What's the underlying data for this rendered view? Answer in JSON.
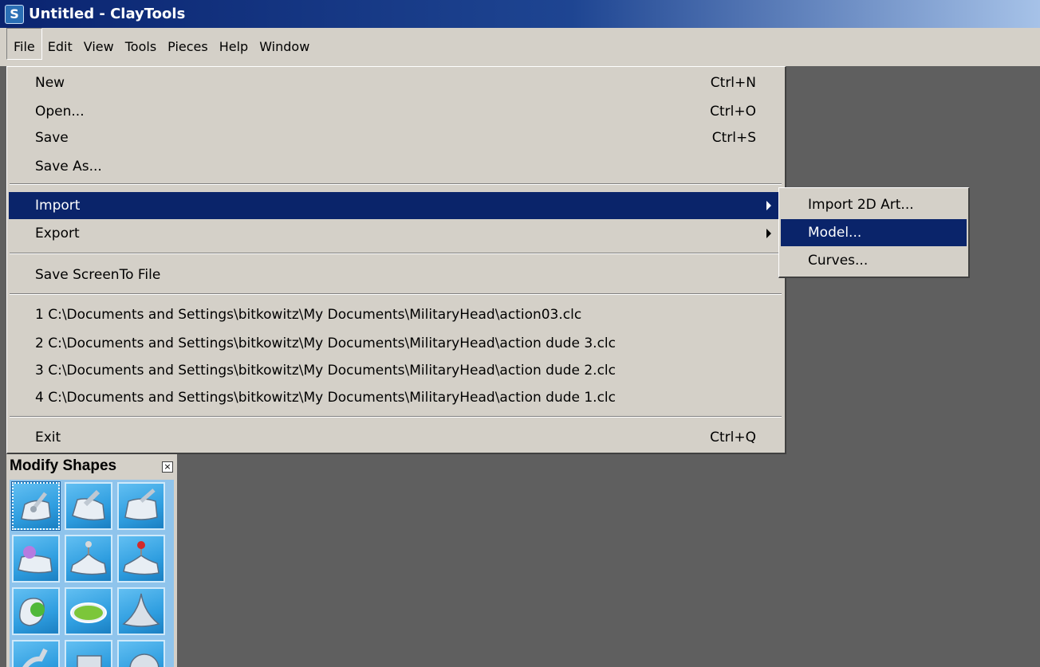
{
  "window": {
    "title": "Untitled - ClayTools",
    "icon": "app-logo-icon"
  },
  "menubar": {
    "items": [
      {
        "label": "File",
        "open": true
      },
      {
        "label": "Edit"
      },
      {
        "label": "View"
      },
      {
        "label": "Tools"
      },
      {
        "label": "Pieces"
      },
      {
        "label": "Help"
      },
      {
        "label": "Window"
      }
    ]
  },
  "file_menu": {
    "new": {
      "label": "New",
      "shortcut": "Ctrl+N"
    },
    "open": {
      "label": "Open...",
      "shortcut": "Ctrl+O"
    },
    "save": {
      "label": "Save",
      "shortcut": "Ctrl+S"
    },
    "save_as": {
      "label": "Save As..."
    },
    "import": {
      "label": "Import",
      "has_submenu": true,
      "highlighted": true
    },
    "export": {
      "label": "Export",
      "has_submenu": true
    },
    "save_screen": {
      "label": "Save ScreenTo File"
    },
    "recent": [
      "1 C:\\Documents and Settings\\bitkowitz\\My Documents\\MilitaryHead\\action03.clc",
      "2 C:\\Documents and Settings\\bitkowitz\\My Documents\\MilitaryHead\\action dude 3.clc",
      "3 C:\\Documents and Settings\\bitkowitz\\My Documents\\MilitaryHead\\action dude 2.clc",
      "4 C:\\Documents and Settings\\bitkowitz\\My Documents\\MilitaryHead\\action dude 1.clc"
    ],
    "exit": {
      "label": "Exit",
      "shortcut": "Ctrl+Q"
    }
  },
  "import_submenu": {
    "items": [
      {
        "label": "Import 2D Art..."
      },
      {
        "label": "Model...",
        "highlighted": true
      },
      {
        "label": "Curves..."
      }
    ]
  },
  "modify_shapes_panel": {
    "title": "Modify Shapes",
    "close_glyph": "×",
    "tools": [
      "carve-tool-icon",
      "smooth-tool-icon",
      "tug-tool-icon",
      "sphere-push-tool-icon",
      "pin-pull-tool-icon",
      "pin-red-tool-icon",
      "ball-tool-icon",
      "ring-tool-icon",
      "cone-tool-icon",
      "pipe-tool-icon",
      "block-tool-icon",
      "dome-tool-icon"
    ],
    "selected_index": 0
  },
  "colors": {
    "titlebar_start": "#0a2470",
    "menu_bg": "#d4d0c8",
    "highlight": "#0a246a",
    "workspace": "#5f5f5f",
    "tool_bg": "#2f9ee0"
  }
}
